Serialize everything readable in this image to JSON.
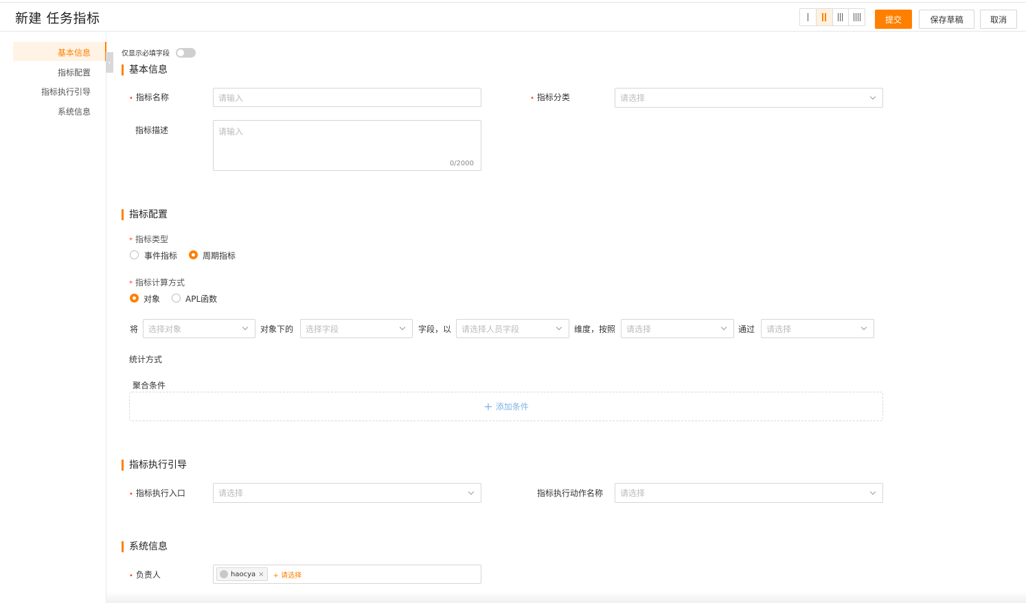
{
  "header": {
    "title": "新建 任务指标",
    "submit_label": "提交",
    "draft_label": "保存草稿",
    "cancel_label": "取消",
    "layout_options": [
      "1-column",
      "2-column",
      "3-column",
      "4-column"
    ],
    "layout_selected": "2-column"
  },
  "nav": {
    "items": [
      "基本信息",
      "指标配置",
      "指标执行引导",
      "系统信息"
    ],
    "active": "基本信息"
  },
  "toggle": {
    "label": "仅显示必填字段",
    "on": false
  },
  "basic": {
    "title": "基本信息",
    "name_label": "指标名称",
    "name_placeholder": "请输入",
    "category_label": "指标分类",
    "category_placeholder": "请选择",
    "desc_label": "指标描述",
    "desc_placeholder": "请输入",
    "desc_counter": "0/2000"
  },
  "config": {
    "title": "指标配置",
    "type_label": "指标类型",
    "type_options": [
      "事件指标",
      "周期指标"
    ],
    "type_selected": "周期指标",
    "calc_label": "指标计算方式",
    "calc_options": [
      "对象",
      "APL函数"
    ],
    "calc_selected": "对象",
    "sentence": {
      "word1": "将",
      "object_placeholder": "选择对象",
      "word2": "对象下的",
      "field_placeholder": "选择字段",
      "word3": "字段，以",
      "person_placeholder": "请选择人员字段",
      "word4": "维度，按照",
      "dim_placeholder": "请选择",
      "word5": "通过",
      "via_placeholder": "请选择"
    },
    "stat_label": "统计方式",
    "agg_label": "聚合条件",
    "add_condition": "添加条件"
  },
  "guide": {
    "title": "指标执行引导",
    "entry_label": "指标执行入口",
    "entry_placeholder": "请选择",
    "action_label": "指标执行动作名称",
    "action_placeholder": "请选择"
  },
  "system": {
    "title": "系统信息",
    "owner_label": "负责人",
    "owner_tag": "haocya",
    "owner_add": "+ 请选择"
  },
  "colors": {
    "accent": "#ff8000",
    "required": "#ff3b30",
    "link": "#7fb5e6"
  }
}
